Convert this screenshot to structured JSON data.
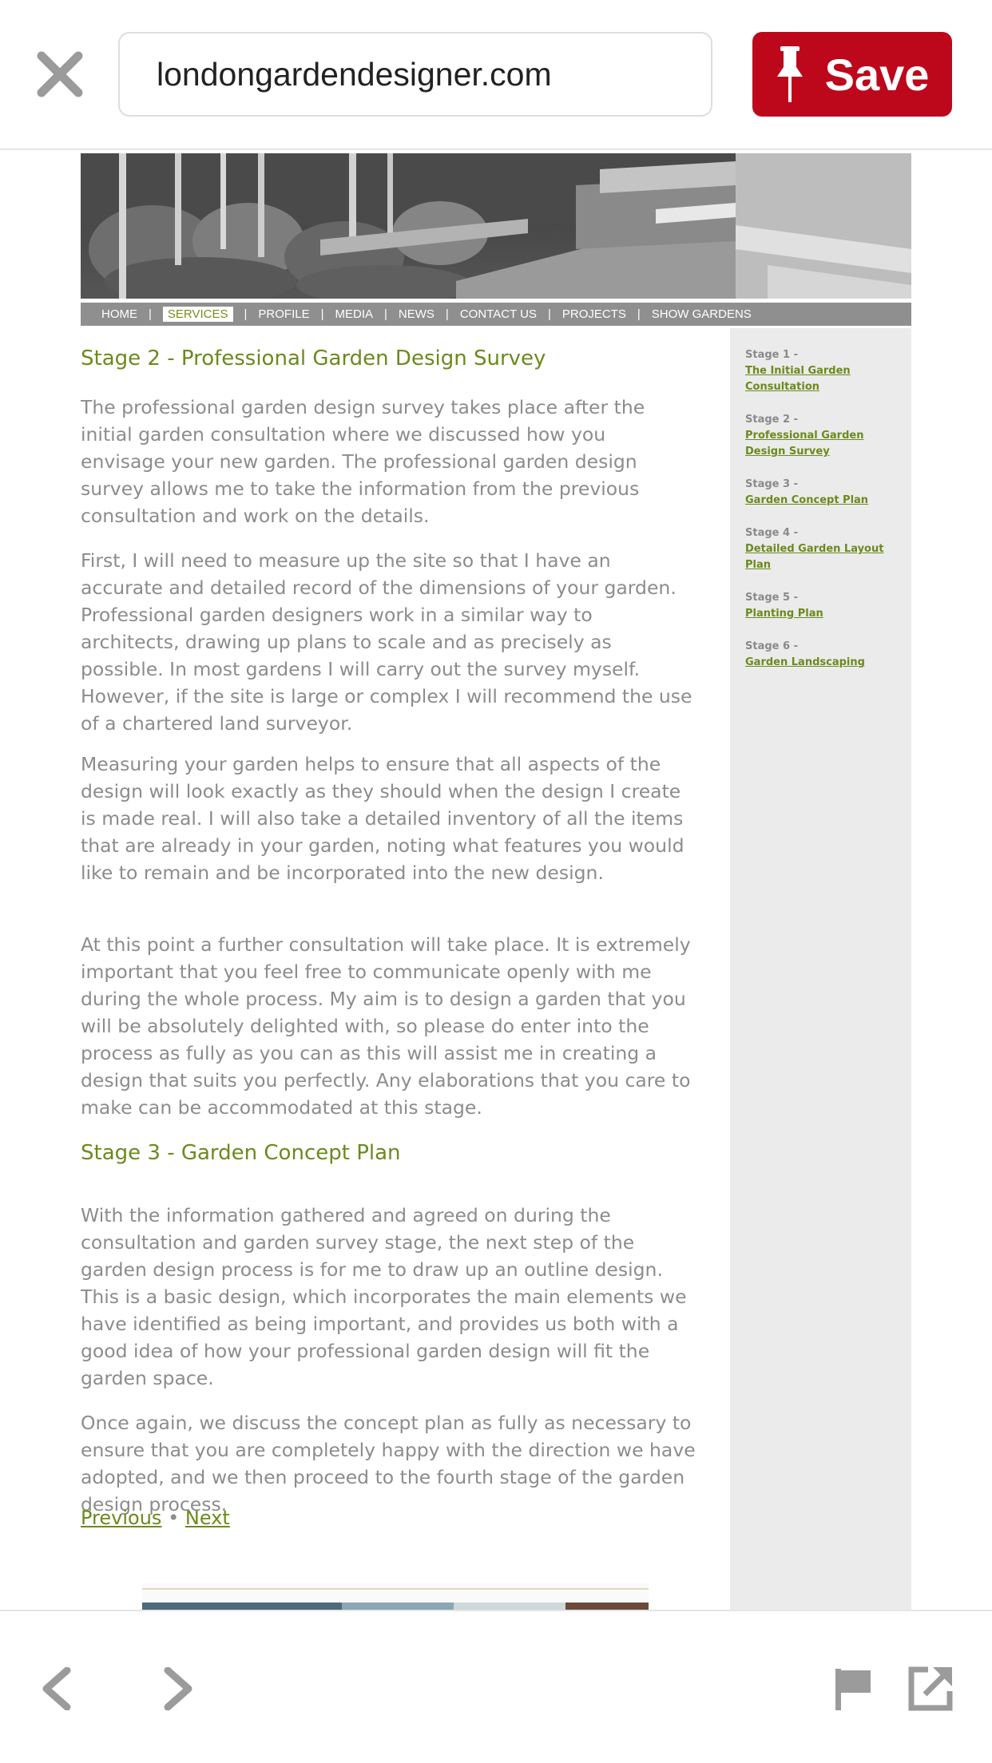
{
  "toolbar": {
    "url": "londongardendesigner.com",
    "save_label": "Save",
    "save_color": "#bd081c"
  },
  "site": {
    "nav": [
      "HOME",
      "SERVICES",
      "PROFILE",
      "MEDIA",
      "NEWS",
      "CONTACT US",
      "PROJECTS",
      "SHOW GARDENS"
    ],
    "active_nav": "SERVICES",
    "sidebar": [
      {
        "stage": "Stage 1 -",
        "title": "The Initial Garden Consultation"
      },
      {
        "stage": "Stage 2 -",
        "title": "Professional Garden Design Survey"
      },
      {
        "stage": "Stage 3 -",
        "title": "Garden Concept Plan"
      },
      {
        "stage": "Stage 4 -",
        "title": "Detailed Garden Layout Plan"
      },
      {
        "stage": "Stage 5 -",
        "title": "Planting Plan"
      },
      {
        "stage": "Stage 6 -",
        "title": "Garden Landscaping"
      }
    ],
    "sections": [
      {
        "heading": "Stage 2 - Professional Garden Design Survey",
        "paragraphs": [
          "The professional garden design survey takes place after the initial garden consultation where we discussed how you envisage your new garden. The professional garden design survey allows me to take the information from the previous consultation and work on the details.",
          "First, I will need to measure up the site so that I have an accurate and detailed record of the dimensions of your garden. Professional garden designers work in a similar way to architects, drawing up plans to scale and as precisely as possible. In most gardens I will carry out the survey myself. However, if the site is large or complex I will recommend the use of a chartered land surveyor.",
          "Measuring your garden helps to ensure that all aspects of the design will look exactly as they should when the design I create is made real. I will also take a detailed inventory of all the items that are already in your garden, noting what features you would like to remain and be incorporated into the new design.",
          "At this point a further consultation will take place. It is extremely important that you feel free to communicate openly with me during the whole process. My aim is to design a garden that you will be absolutely delighted with, so please do enter into the process as fully as you can as this will assist me in creating a design that suits you perfectly. Any elaborations that you care to make can be accommodated at this stage."
        ]
      },
      {
        "heading": "Stage 3 - Garden Concept Plan",
        "paragraphs": [
          "With the information gathered and agreed on during the consultation and garden survey stage, the next step of the garden design process is for me to draw up an outline design. This is a basic design, which incorporates the main elements we have identified as being important, and provides us both with a good idea of how your professional garden design will fit the garden space.",
          "Once again, we discuss the concept plan as fully as necessary to ensure that you are completely happy with the direction we have adopted, and we then proceed to the fourth stage of the garden design process."
        ]
      }
    ],
    "pager": {
      "previous": "Previous",
      "separator": "•",
      "next": "Next"
    }
  },
  "bottom_bar": {
    "icons": [
      "back-arrow-icon",
      "forward-arrow-icon",
      "flag-icon",
      "external-link-icon"
    ]
  },
  "colors": {
    "link_green": "#6b8a1c",
    "body_text": "#8c8c8c",
    "sidebar_bg": "#ebebeb"
  }
}
